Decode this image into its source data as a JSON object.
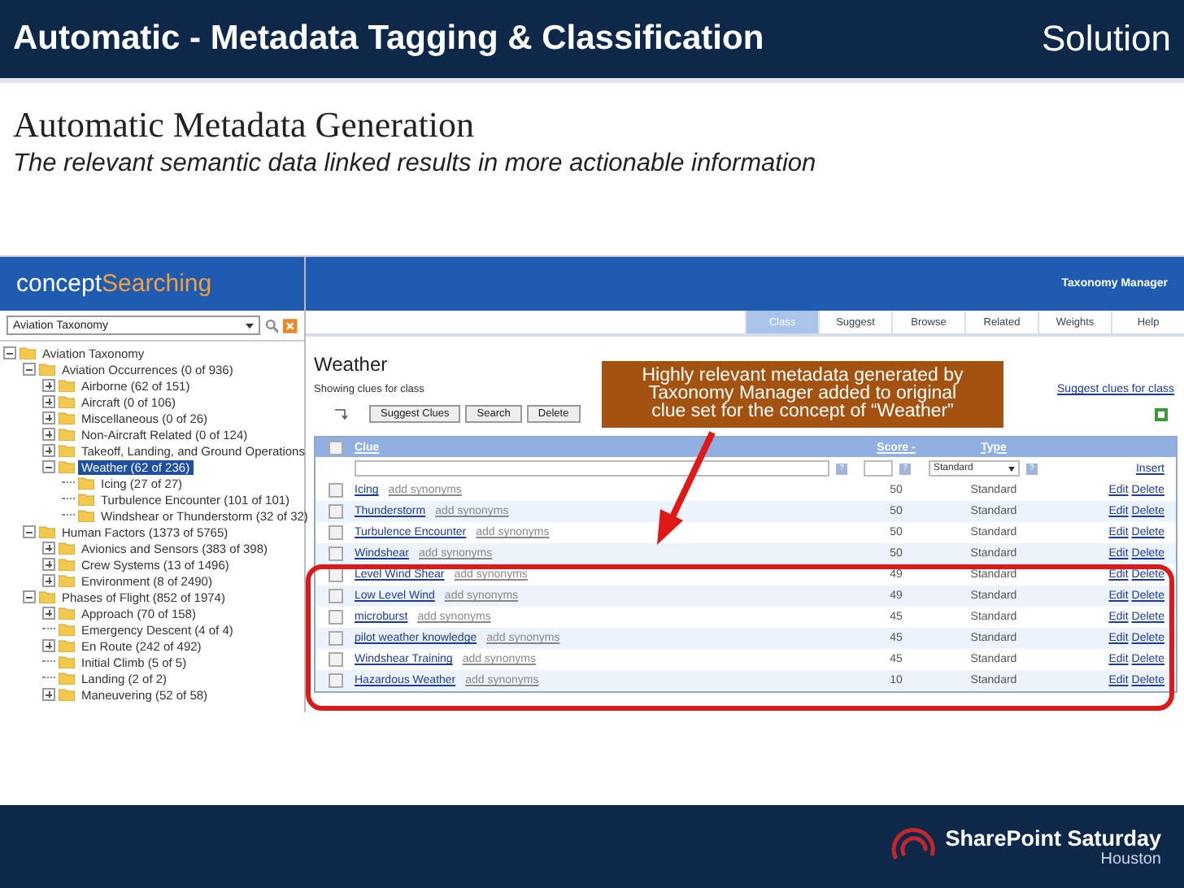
{
  "slide": {
    "title": "Automatic - Metadata Tagging & Classification",
    "section": "Solution",
    "heading": "Automatic Metadata Generation",
    "subheading": "The relevant semantic data linked results in more actionable information"
  },
  "app": {
    "logo": [
      "concept",
      "Searching"
    ],
    "taxonomy_picker": {
      "value": "Aviation Taxonomy"
    },
    "product": "Taxonomy Manager",
    "tabs": [
      {
        "label": "Class",
        "selected": true
      },
      {
        "label": "Suggest",
        "selected": false
      },
      {
        "label": "Browse",
        "selected": false
      },
      {
        "label": "Related",
        "selected": false
      },
      {
        "label": "Weights",
        "selected": false
      },
      {
        "label": "Help",
        "selected": false
      }
    ],
    "tree": [
      {
        "label": "Aviation Taxonomy",
        "kind": "branch",
        "expanded": true,
        "selected": false,
        "children": [
          {
            "label": "Aviation Occurrences (0 of 936)",
            "kind": "branch",
            "expanded": true,
            "selected": false,
            "children": [
              {
                "label": "Airborne (62 of 151)",
                "kind": "branch",
                "expanded": false,
                "selected": false
              },
              {
                "label": "Aircraft (0 of 106)",
                "kind": "branch",
                "expanded": false,
                "selected": false
              },
              {
                "label": "Miscellaneous (0 of 26)",
                "kind": "branch",
                "expanded": false,
                "selected": false
              },
              {
                "label": "Non-Aircraft Related (0 of 124)",
                "kind": "branch",
                "expanded": false,
                "selected": false
              },
              {
                "label": "Takeoff, Landing, and Ground Operations",
                "kind": "branch",
                "expanded": false,
                "selected": false
              },
              {
                "label": "Weather (62 of 236)",
                "kind": "branch",
                "expanded": true,
                "selected": true,
                "children": [
                  {
                    "label": "Icing (27 of 27)",
                    "kind": "leaf",
                    "selected": false
                  },
                  {
                    "label": "Turbulence Encounter (101 of 101)",
                    "kind": "leaf",
                    "selected": false
                  },
                  {
                    "label": "Windshear or Thunderstorm (32 of 32)",
                    "kind": "leaf",
                    "selected": false
                  }
                ]
              }
            ]
          },
          {
            "label": "Human Factors (1373 of 5765)",
            "kind": "branch",
            "expanded": true,
            "selected": false,
            "children": [
              {
                "label": "Avionics and Sensors (383 of 398)",
                "kind": "branch",
                "expanded": false,
                "selected": false
              },
              {
                "label": "Crew Systems (13 of 1496)",
                "kind": "branch",
                "expanded": false,
                "selected": false
              },
              {
                "label": "Environment (8 of 2490)",
                "kind": "branch",
                "expanded": false,
                "selected": false
              }
            ]
          },
          {
            "label": "Phases of Flight (852 of 1974)",
            "kind": "branch",
            "expanded": true,
            "selected": false,
            "children": [
              {
                "label": "Approach (70 of 158)",
                "kind": "branch",
                "expanded": false,
                "selected": false
              },
              {
                "label": "Emergency Descent (4 of 4)",
                "kind": "leaf",
                "selected": false
              },
              {
                "label": "En Route (242 of 492)",
                "kind": "branch",
                "expanded": false,
                "selected": false
              },
              {
                "label": "Initial Climb (5 of 5)",
                "kind": "leaf",
                "selected": false
              },
              {
                "label": "Landing (2 of 2)",
                "kind": "leaf",
                "selected": false
              },
              {
                "label": "Maneuvering (52 of 58)",
                "kind": "branch",
                "expanded": false,
                "selected": false
              }
            ]
          }
        ]
      }
    ],
    "class_title": "Weather",
    "class_caption": "Showing clues for class",
    "suggest_link": "Suggest clues for class",
    "buttons": [
      "Suggest Clues",
      "Search",
      "Delete"
    ],
    "table": {
      "select_all_checked": false,
      "columns": [
        "Clue",
        "Score -",
        "Type"
      ],
      "filter": {
        "help": "?",
        "type": "Standard",
        "action": "Insert"
      },
      "rows": [
        {
          "clue": "Icing",
          "synonyms": "add synonyms",
          "score": "50",
          "type": "Standard",
          "edit": "Edit",
          "delete": "Delete",
          "checked": false
        },
        {
          "clue": "Thunderstorm",
          "synonyms": "add synonyms",
          "score": "50",
          "type": "Standard",
          "edit": "Edit",
          "delete": "Delete",
          "checked": false
        },
        {
          "clue": "Turbulence Encounter",
          "synonyms": "add synonyms",
          "score": "50",
          "type": "Standard",
          "edit": "Edit",
          "delete": "Delete",
          "checked": false
        },
        {
          "clue": "Windshear",
          "synonyms": "add synonyms",
          "score": "50",
          "type": "Standard",
          "edit": "Edit",
          "delete": "Delete",
          "checked": false
        },
        {
          "clue": "Level Wind Shear",
          "synonyms": "add synonyms",
          "score": "49",
          "type": "Standard",
          "edit": "Edit",
          "delete": "Delete",
          "checked": false
        },
        {
          "clue": "Low Level Wind",
          "synonyms": "add synonyms",
          "score": "49",
          "type": "Standard",
          "edit": "Edit",
          "delete": "Delete",
          "checked": false
        },
        {
          "clue": "microburst",
          "synonyms": "add synonyms",
          "score": "45",
          "type": "Standard",
          "edit": "Edit",
          "delete": "Delete",
          "checked": false
        },
        {
          "clue": "pilot weather knowledge",
          "synonyms": "add synonyms",
          "score": "45",
          "type": "Standard",
          "edit": "Edit",
          "delete": "Delete",
          "checked": false
        },
        {
          "clue": "Windshear Training",
          "synonyms": "add synonyms",
          "score": "45",
          "type": "Standard",
          "edit": "Edit",
          "delete": "Delete",
          "checked": false
        },
        {
          "clue": "Hazardous Weather",
          "synonyms": "add synonyms",
          "score": "10",
          "type": "Standard",
          "edit": "Edit",
          "delete": "Delete",
          "checked": false
        }
      ]
    },
    "callout": [
      "Highly relevant metadata generated by",
      "Taxonomy Manager added to original",
      "clue set for the concept of “Weather”"
    ]
  },
  "footer": {
    "brand": "SharePoint Saturday",
    "city": "Houston"
  }
}
